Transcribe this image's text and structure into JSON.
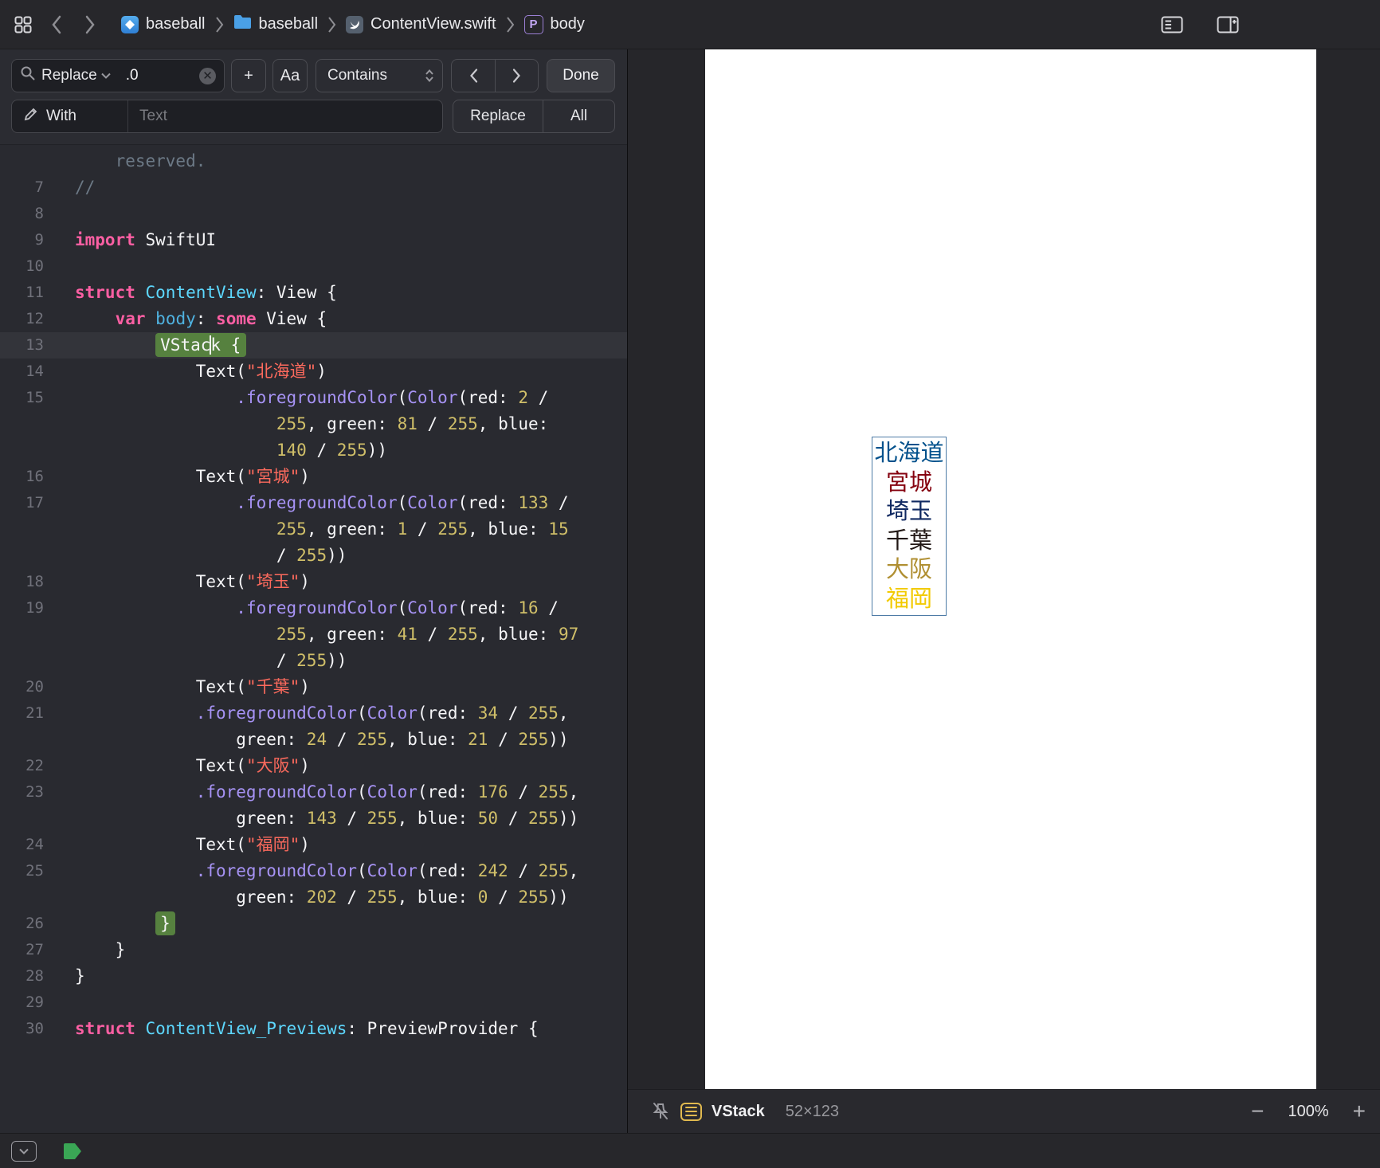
{
  "toolbar": {
    "breadcrumb": {
      "project": "baseball",
      "group": "baseball",
      "file": "ContentView.swift",
      "symbol": "body",
      "symbol_badge": "P"
    }
  },
  "findbar": {
    "mode_label": "Replace",
    "search_value": ".0",
    "add_label": "+",
    "match_case_label": "Aa",
    "match_type_label": "Contains",
    "done_label": "Done",
    "with_label": "With",
    "with_placeholder": "Text",
    "replace_label": "Replace",
    "all_label": "All"
  },
  "code": {
    "rows": [
      {
        "n": "",
        "t": [
          [
            "cmt",
            "    reserved."
          ]
        ]
      },
      {
        "n": "7",
        "t": [
          [
            "cmt",
            "//"
          ]
        ]
      },
      {
        "n": "8",
        "t": []
      },
      {
        "n": "9",
        "t": [
          [
            "kw",
            "import"
          ],
          [
            "pl",
            " SwiftUI"
          ]
        ]
      },
      {
        "n": "10",
        "t": []
      },
      {
        "n": "11",
        "t": [
          [
            "kw",
            "struct"
          ],
          [
            "pl",
            " "
          ],
          [
            "ty",
            "ContentView"
          ],
          [
            "pl",
            ": View {"
          ]
        ]
      },
      {
        "n": "12",
        "t": [
          [
            "pl",
            "    "
          ],
          [
            "kw",
            "var"
          ],
          [
            "pl",
            " "
          ],
          [
            "pr",
            "body"
          ],
          [
            "pl",
            ": "
          ],
          [
            "kw",
            "some"
          ],
          [
            "pl",
            " View {"
          ]
        ]
      },
      {
        "n": "13",
        "cur": true,
        "t": [
          [
            "pl",
            "        "
          ],
          [
            "selL",
            "VStac"
          ],
          [
            "caret",
            ""
          ],
          [
            "selR",
            "k {"
          ]
        ]
      },
      {
        "n": "14",
        "t": [
          [
            "pl",
            "            Text("
          ],
          [
            "st",
            "\"北海道\""
          ],
          [
            "pl",
            ")"
          ]
        ]
      },
      {
        "n": "15",
        "t": [
          [
            "pl",
            "                "
          ],
          [
            "fn",
            ".foregroundColor"
          ],
          [
            "pl",
            "("
          ],
          [
            "fn",
            "Color"
          ],
          [
            "pl",
            "(red: "
          ],
          [
            "nu",
            "2"
          ],
          [
            "pl",
            " /"
          ]
        ]
      },
      {
        "n": "",
        "t": [
          [
            "pl",
            "                    "
          ],
          [
            "nu",
            "255"
          ],
          [
            "pl",
            ", green: "
          ],
          [
            "nu",
            "81"
          ],
          [
            "pl",
            " / "
          ],
          [
            "nu",
            "255"
          ],
          [
            "pl",
            ", blue:"
          ]
        ]
      },
      {
        "n": "",
        "t": [
          [
            "pl",
            "                    "
          ],
          [
            "nu",
            "140"
          ],
          [
            "pl",
            " / "
          ],
          [
            "nu",
            "255"
          ],
          [
            "pl",
            "))"
          ]
        ]
      },
      {
        "n": "16",
        "t": [
          [
            "pl",
            "            Text("
          ],
          [
            "st",
            "\"宮城\""
          ],
          [
            "pl",
            ")"
          ]
        ]
      },
      {
        "n": "17",
        "t": [
          [
            "pl",
            "                "
          ],
          [
            "fn",
            ".foregroundColor"
          ],
          [
            "pl",
            "("
          ],
          [
            "fn",
            "Color"
          ],
          [
            "pl",
            "(red: "
          ],
          [
            "nu",
            "133"
          ],
          [
            "pl",
            " /"
          ]
        ]
      },
      {
        "n": "",
        "t": [
          [
            "pl",
            "                    "
          ],
          [
            "nu",
            "255"
          ],
          [
            "pl",
            ", green: "
          ],
          [
            "nu",
            "1"
          ],
          [
            "pl",
            " / "
          ],
          [
            "nu",
            "255"
          ],
          [
            "pl",
            ", blue: "
          ],
          [
            "nu",
            "15"
          ]
        ]
      },
      {
        "n": "",
        "t": [
          [
            "pl",
            "                    / "
          ],
          [
            "nu",
            "255"
          ],
          [
            "pl",
            "))"
          ]
        ]
      },
      {
        "n": "18",
        "t": [
          [
            "pl",
            "            Text("
          ],
          [
            "st",
            "\"埼玉\""
          ],
          [
            "pl",
            ")"
          ]
        ]
      },
      {
        "n": "19",
        "t": [
          [
            "pl",
            "                "
          ],
          [
            "fn",
            ".foregroundColor"
          ],
          [
            "pl",
            "("
          ],
          [
            "fn",
            "Color"
          ],
          [
            "pl",
            "(red: "
          ],
          [
            "nu",
            "16"
          ],
          [
            "pl",
            " /"
          ]
        ]
      },
      {
        "n": "",
        "t": [
          [
            "pl",
            "                    "
          ],
          [
            "nu",
            "255"
          ],
          [
            "pl",
            ", green: "
          ],
          [
            "nu",
            "41"
          ],
          [
            "pl",
            " / "
          ],
          [
            "nu",
            "255"
          ],
          [
            "pl",
            ", blue: "
          ],
          [
            "nu",
            "97"
          ]
        ]
      },
      {
        "n": "",
        "t": [
          [
            "pl",
            "                    / "
          ],
          [
            "nu",
            "255"
          ],
          [
            "pl",
            "))"
          ]
        ]
      },
      {
        "n": "20",
        "t": [
          [
            "pl",
            "            Text("
          ],
          [
            "st",
            "\"千葉\""
          ],
          [
            "pl",
            ")"
          ]
        ]
      },
      {
        "n": "21",
        "t": [
          [
            "pl",
            "            "
          ],
          [
            "fn",
            ".foregroundColor"
          ],
          [
            "pl",
            "("
          ],
          [
            "fn",
            "Color"
          ],
          [
            "pl",
            "(red: "
          ],
          [
            "nu",
            "34"
          ],
          [
            "pl",
            " / "
          ],
          [
            "nu",
            "255"
          ],
          [
            "pl",
            ","
          ]
        ]
      },
      {
        "n": "",
        "t": [
          [
            "pl",
            "                green: "
          ],
          [
            "nu",
            "24"
          ],
          [
            "pl",
            " / "
          ],
          [
            "nu",
            "255"
          ],
          [
            "pl",
            ", blue: "
          ],
          [
            "nu",
            "21"
          ],
          [
            "pl",
            " / "
          ],
          [
            "nu",
            "255"
          ],
          [
            "pl",
            "))"
          ]
        ]
      },
      {
        "n": "22",
        "t": [
          [
            "pl",
            "            Text("
          ],
          [
            "st",
            "\"大阪\""
          ],
          [
            "pl",
            ")"
          ]
        ]
      },
      {
        "n": "23",
        "t": [
          [
            "pl",
            "            "
          ],
          [
            "fn",
            ".foregroundColor"
          ],
          [
            "pl",
            "("
          ],
          [
            "fn",
            "Color"
          ],
          [
            "pl",
            "(red: "
          ],
          [
            "nu",
            "176"
          ],
          [
            "pl",
            " / "
          ],
          [
            "nu",
            "255"
          ],
          [
            "pl",
            ","
          ]
        ]
      },
      {
        "n": "",
        "t": [
          [
            "pl",
            "                green: "
          ],
          [
            "nu",
            "143"
          ],
          [
            "pl",
            " / "
          ],
          [
            "nu",
            "255"
          ],
          [
            "pl",
            ", blue: "
          ],
          [
            "nu",
            "50"
          ],
          [
            "pl",
            " / "
          ],
          [
            "nu",
            "255"
          ],
          [
            "pl",
            "))"
          ]
        ]
      },
      {
        "n": "24",
        "t": [
          [
            "pl",
            "            Text("
          ],
          [
            "st",
            "\"福岡\""
          ],
          [
            "pl",
            ")"
          ]
        ]
      },
      {
        "n": "25",
        "t": [
          [
            "pl",
            "            "
          ],
          [
            "fn",
            ".foregroundColor"
          ],
          [
            "pl",
            "("
          ],
          [
            "fn",
            "Color"
          ],
          [
            "pl",
            "(red: "
          ],
          [
            "nu",
            "242"
          ],
          [
            "pl",
            " / "
          ],
          [
            "nu",
            "255"
          ],
          [
            "pl",
            ","
          ]
        ]
      },
      {
        "n": "",
        "t": [
          [
            "pl",
            "                green: "
          ],
          [
            "nu",
            "202"
          ],
          [
            "pl",
            " / "
          ],
          [
            "nu",
            "255"
          ],
          [
            "pl",
            ", blue: "
          ],
          [
            "nu",
            "0"
          ],
          [
            "pl",
            " / "
          ],
          [
            "nu",
            "255"
          ],
          [
            "pl",
            "))"
          ]
        ]
      },
      {
        "n": "26",
        "t": [
          [
            "pl",
            "        "
          ],
          [
            "sel",
            "}"
          ]
        ]
      },
      {
        "n": "27",
        "t": [
          [
            "pl",
            "    }"
          ]
        ]
      },
      {
        "n": "28",
        "t": [
          [
            "pl",
            "}"
          ]
        ]
      },
      {
        "n": "29",
        "t": []
      },
      {
        "n": "30",
        "t": [
          [
            "kw",
            "struct"
          ],
          [
            "pl",
            " "
          ],
          [
            "ty",
            "ContentView_Previews"
          ],
          [
            "pl",
            ": PreviewProvider {"
          ]
        ]
      }
    ]
  },
  "preview": {
    "items": [
      {
        "text": "北海道",
        "color": "rgb(2,81,140)"
      },
      {
        "text": "宮城",
        "color": "rgb(133,1,15)"
      },
      {
        "text": "埼玉",
        "color": "rgb(16,41,97)"
      },
      {
        "text": "千葉",
        "color": "rgb(34,24,21)"
      },
      {
        "text": "大阪",
        "color": "rgb(176,143,50)"
      },
      {
        "text": "福岡",
        "color": "rgb(242,202,0)"
      }
    ],
    "bar": {
      "selected_view": "VStack",
      "size": "52×123",
      "zoom": "100%",
      "zoom_out": "−",
      "zoom_in": "+"
    }
  }
}
